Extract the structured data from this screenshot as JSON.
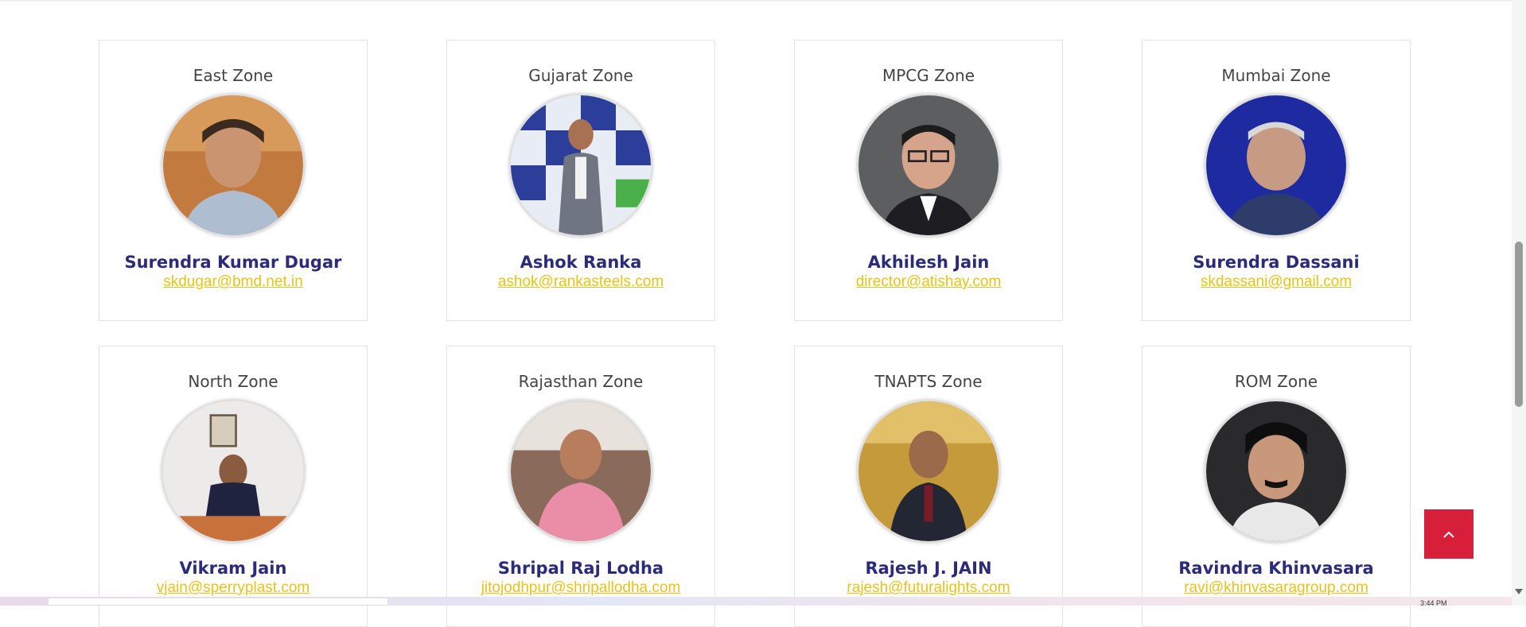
{
  "cards": [
    {
      "zone": "East Zone",
      "name": "Surendra Kumar Dugar",
      "email": "skdugar@bmd.net.in"
    },
    {
      "zone": "Gujarat Zone",
      "name": "Ashok Ranka",
      "email": "ashok@rankasteels.com"
    },
    {
      "zone": "MPCG Zone",
      "name": "Akhilesh Jain",
      "email": "director@atishay.com"
    },
    {
      "zone": "Mumbai Zone",
      "name": "Surendra Dassani",
      "email": "skdassani@gmail.com"
    },
    {
      "zone": "North Zone",
      "name": "Vikram Jain",
      "email": "vjain@sperryplast.com"
    },
    {
      "zone": "Rajasthan Zone",
      "name": "Shripal Raj Lodha",
      "email": "jitojodhpur@shripallodha.com"
    },
    {
      "zone": "TNAPTS Zone",
      "name": "Rajesh J. JAIN",
      "email": "rajesh@futuralights.com"
    },
    {
      "zone": "ROM Zone",
      "name": "Ravindra Khinvasara",
      "email": "ravi@khinvasaragroup.com"
    }
  ],
  "colors": {
    "name": "#2c2a7a",
    "email": "#e8c21a",
    "back_to_top": "#d71f3a"
  },
  "icons": {
    "back_to_top": "chevron-up-icon"
  },
  "taskbar": {
    "time": "3:44 PM"
  }
}
